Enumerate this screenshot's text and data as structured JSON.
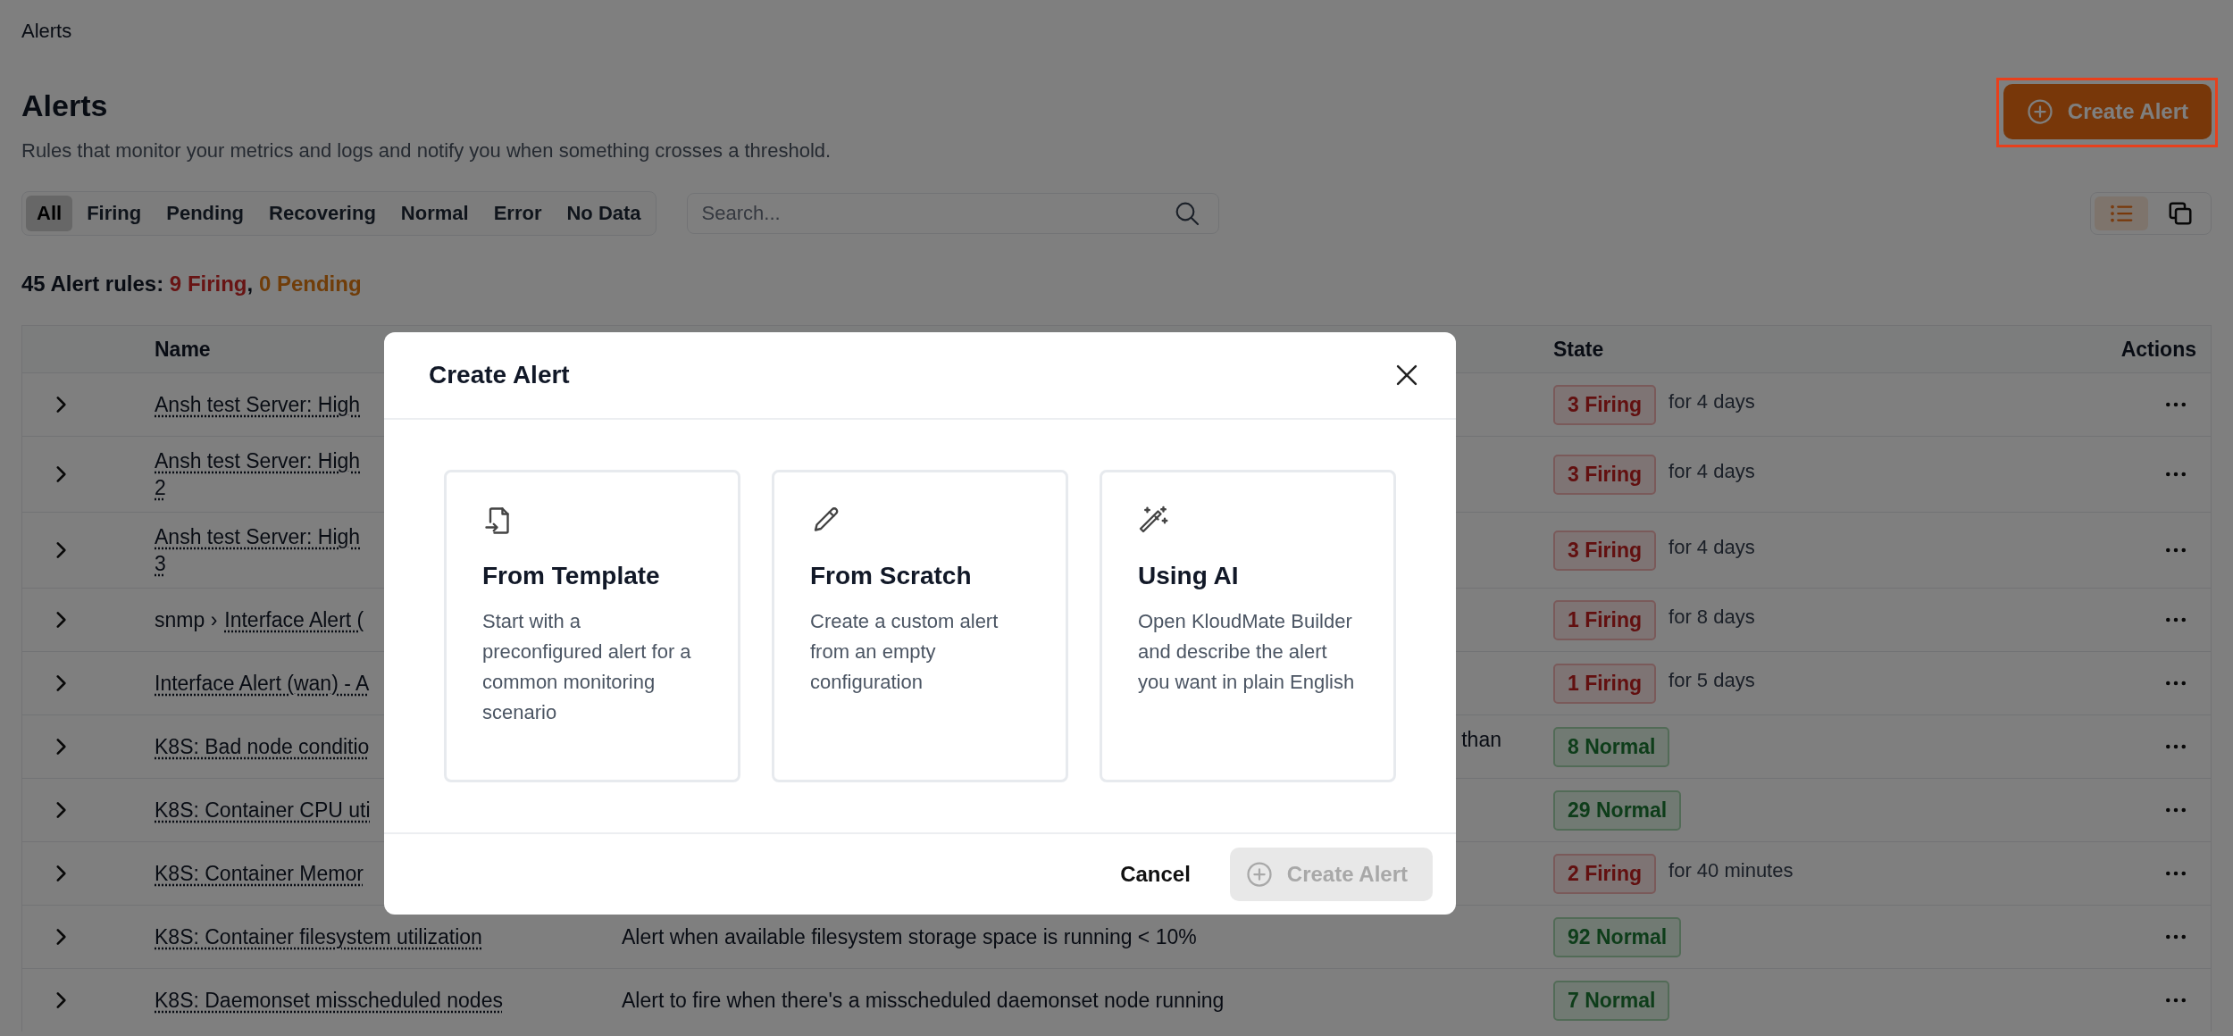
{
  "breadcrumb": "Alerts",
  "header": {
    "title": "Alerts",
    "subtitle": "Rules that monitor your metrics and logs and notify you when something crosses a threshold.",
    "create_button": "Create Alert"
  },
  "filters": [
    {
      "label": "All",
      "selected": true
    },
    {
      "label": "Firing",
      "selected": false
    },
    {
      "label": "Pending",
      "selected": false
    },
    {
      "label": "Recovering",
      "selected": false
    },
    {
      "label": "Normal",
      "selected": false
    },
    {
      "label": "Error",
      "selected": false
    },
    {
      "label": "No Data",
      "selected": false
    }
  ],
  "search": {
    "placeholder": "Search..."
  },
  "view_toggle": [
    {
      "kind": "list",
      "selected": true
    },
    {
      "kind": "cards",
      "selected": false
    }
  ],
  "summary": {
    "total": "45 Alert rules:",
    "firing": "9 Firing",
    "separator": ",",
    "pending": "0 Pending"
  },
  "table": {
    "columns": [
      "Name",
      "State",
      "Actions"
    ],
    "rows": [
      {
        "name_lines": [
          "Ansh test Server: High"
        ],
        "state": {
          "kind": "firing",
          "label": "3 Firing"
        },
        "duration": "for 4 days"
      },
      {
        "name_lines": [
          "Ansh test Server: High",
          "2"
        ],
        "state": {
          "kind": "firing",
          "label": "3 Firing"
        },
        "duration": "for 4 days"
      },
      {
        "name_lines": [
          "Ansh test Server: High",
          "3"
        ],
        "state": {
          "kind": "firing",
          "label": "3 Firing"
        },
        "duration": "for 4 days"
      },
      {
        "group": "snmp ›",
        "name_lines": [
          "Interface Alert ("
        ],
        "state": {
          "kind": "firing",
          "label": "1 Firing"
        },
        "duration": "for 8 days"
      },
      {
        "name_lines": [
          "Interface Alert (wan) - A"
        ],
        "state": {
          "kind": "firing",
          "label": "1 Firing"
        },
        "duration": "for 5 days"
      },
      {
        "name_lines": [
          "K8S: Bad node conditio"
        ],
        "description_fragment": "than",
        "state": {
          "kind": "normal",
          "label": "8 Normal"
        }
      },
      {
        "name_lines": [
          "K8S: Container CPU uti"
        ],
        "state": {
          "kind": "normal",
          "label": "29 Normal"
        }
      },
      {
        "name_lines": [
          "K8S: Container Memor"
        ],
        "state": {
          "kind": "firing",
          "label": "2 Firing"
        },
        "duration": "for 40 minutes"
      },
      {
        "name_lines": [
          "K8S: Container filesystem utilization"
        ],
        "description": "Alert when available filesystem storage space is running < 10%",
        "state": {
          "kind": "normal",
          "label": "92 Normal"
        }
      },
      {
        "name_lines": [
          "K8S: Daemonset misscheduled nodes"
        ],
        "description": "Alert to fire when there's a misscheduled daemonset node running",
        "state": {
          "kind": "normal",
          "label": "7 Normal"
        }
      }
    ]
  },
  "modal": {
    "title": "Create Alert",
    "options": [
      {
        "kind": "template",
        "title": "From Template",
        "description": "Start with a preconfigured alert for a common monitoring scenario"
      },
      {
        "kind": "scratch",
        "title": "From Scratch",
        "description": "Create a custom alert from an empty configuration"
      },
      {
        "kind": "ai",
        "title": "Using AI",
        "description": "Open KloudMate Builder and describe the alert you want in plain English"
      }
    ],
    "cancel": "Cancel",
    "submit": {
      "label": "Create Alert",
      "disabled": true
    }
  }
}
